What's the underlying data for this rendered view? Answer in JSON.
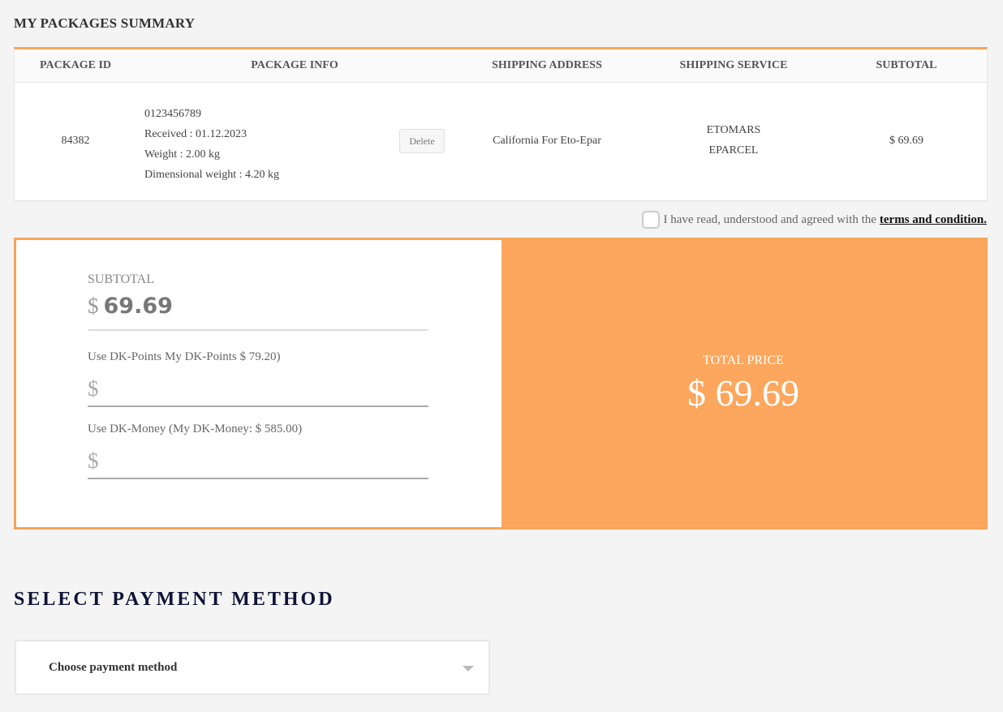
{
  "summary": {
    "title": "MY PACKAGES SUMMARY"
  },
  "table": {
    "headers": {
      "package_id": "PACKAGE ID",
      "package_info": "PACKAGE INFO",
      "shipping_address": "SHIPPING ADDRESS",
      "shipping_service": "SHIPPING SERVICE",
      "subtotal": "SUBTOTAL"
    },
    "rows": [
      {
        "package_id": "84382",
        "tracking": "0123456789",
        "received": "Received : 01.12.2023",
        "weight": "Weight : 2.00 kg",
        "dim_weight": "Dimensional weight : 4.20 kg",
        "delete_label": "Delete",
        "address": "California For Eto-Epar",
        "service_line1": "ETOMARS",
        "service_line2": "EPARCEL",
        "subtotal": "$ 69.69"
      }
    ]
  },
  "terms": {
    "text": "I have read, understood and agreed with the",
    "link": "terms and condition."
  },
  "pricing": {
    "subtotal_label": "SUBTOTAL",
    "currency": "$",
    "subtotal_value": "69.69",
    "dk_points_label": "Use DK-Points My DK-Points $ 79.20)",
    "dk_money_label": "Use DK-Money (My DK-Money: $ 585.00)",
    "total_label": "TOTAL PRICE",
    "total_value": "$ 69.69"
  },
  "payment": {
    "title": "SELECT PAYMENT METHOD",
    "select_placeholder": "Choose payment method"
  },
  "colors": {
    "accent": "#fca75d",
    "border_accent": "#f6a55c",
    "title_dark": "#0f1337"
  },
  "icons": {
    "caret": "chevron-down-icon",
    "checkbox": "checkbox-icon"
  }
}
